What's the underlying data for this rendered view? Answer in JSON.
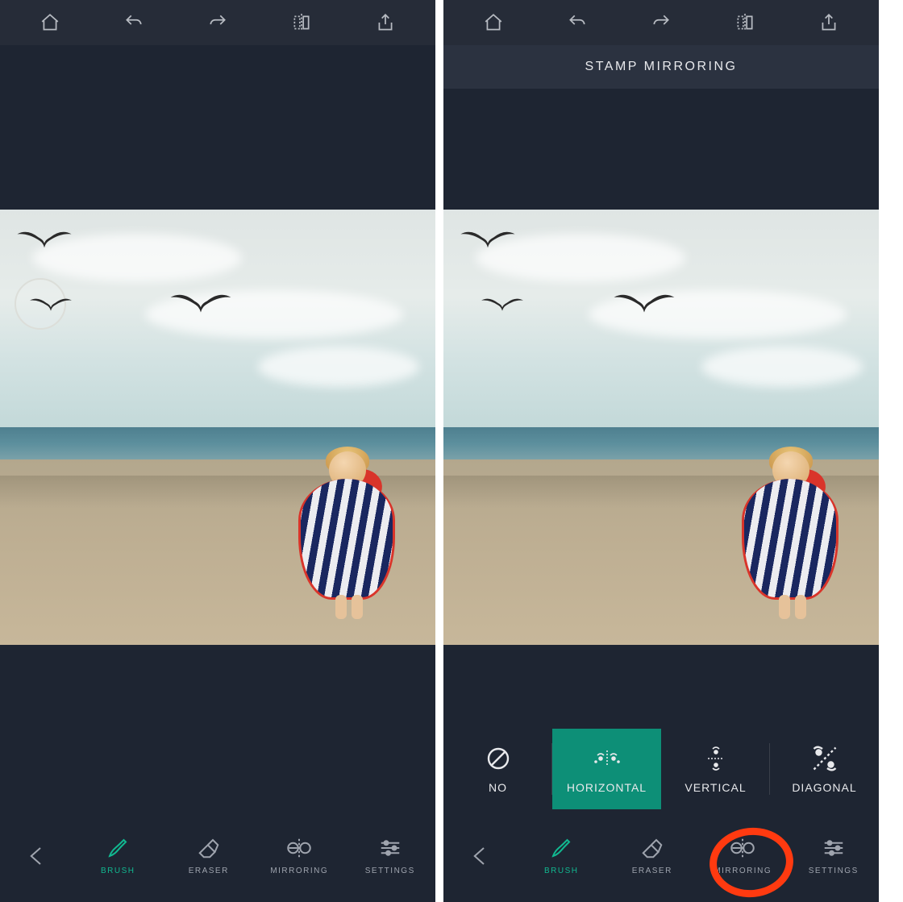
{
  "panel1": {
    "top_icons": [
      "home",
      "undo",
      "redo",
      "compare",
      "share"
    ],
    "tools": {
      "back": "",
      "brush": "BRUSH",
      "eraser": "ERASER",
      "mirroring": "MIRRORING",
      "settings": "SETTINGS"
    },
    "active_tool": "brush"
  },
  "panel2": {
    "top_icons": [
      "home",
      "undo",
      "redo",
      "compare",
      "share"
    ],
    "header": "STAMP MIRRORING",
    "mirror_options": [
      {
        "key": "no",
        "label": "NO"
      },
      {
        "key": "horizontal",
        "label": "HORIZONTAL"
      },
      {
        "key": "vertical",
        "label": "VERTICAL"
      },
      {
        "key": "diagonal",
        "label": "DIAGONAL"
      }
    ],
    "selected_mirror": "horizontal",
    "tools": {
      "back": "",
      "brush": "BRUSH",
      "eraser": "ERASER",
      "mirroring": "MIRRORING",
      "settings": "SETTINGS"
    },
    "active_tool": "brush",
    "highlighted_tool": "mirroring"
  },
  "colors": {
    "accent": "#11b890",
    "selected_bg": "#0d8f77",
    "annotation": "#ff3a10"
  }
}
